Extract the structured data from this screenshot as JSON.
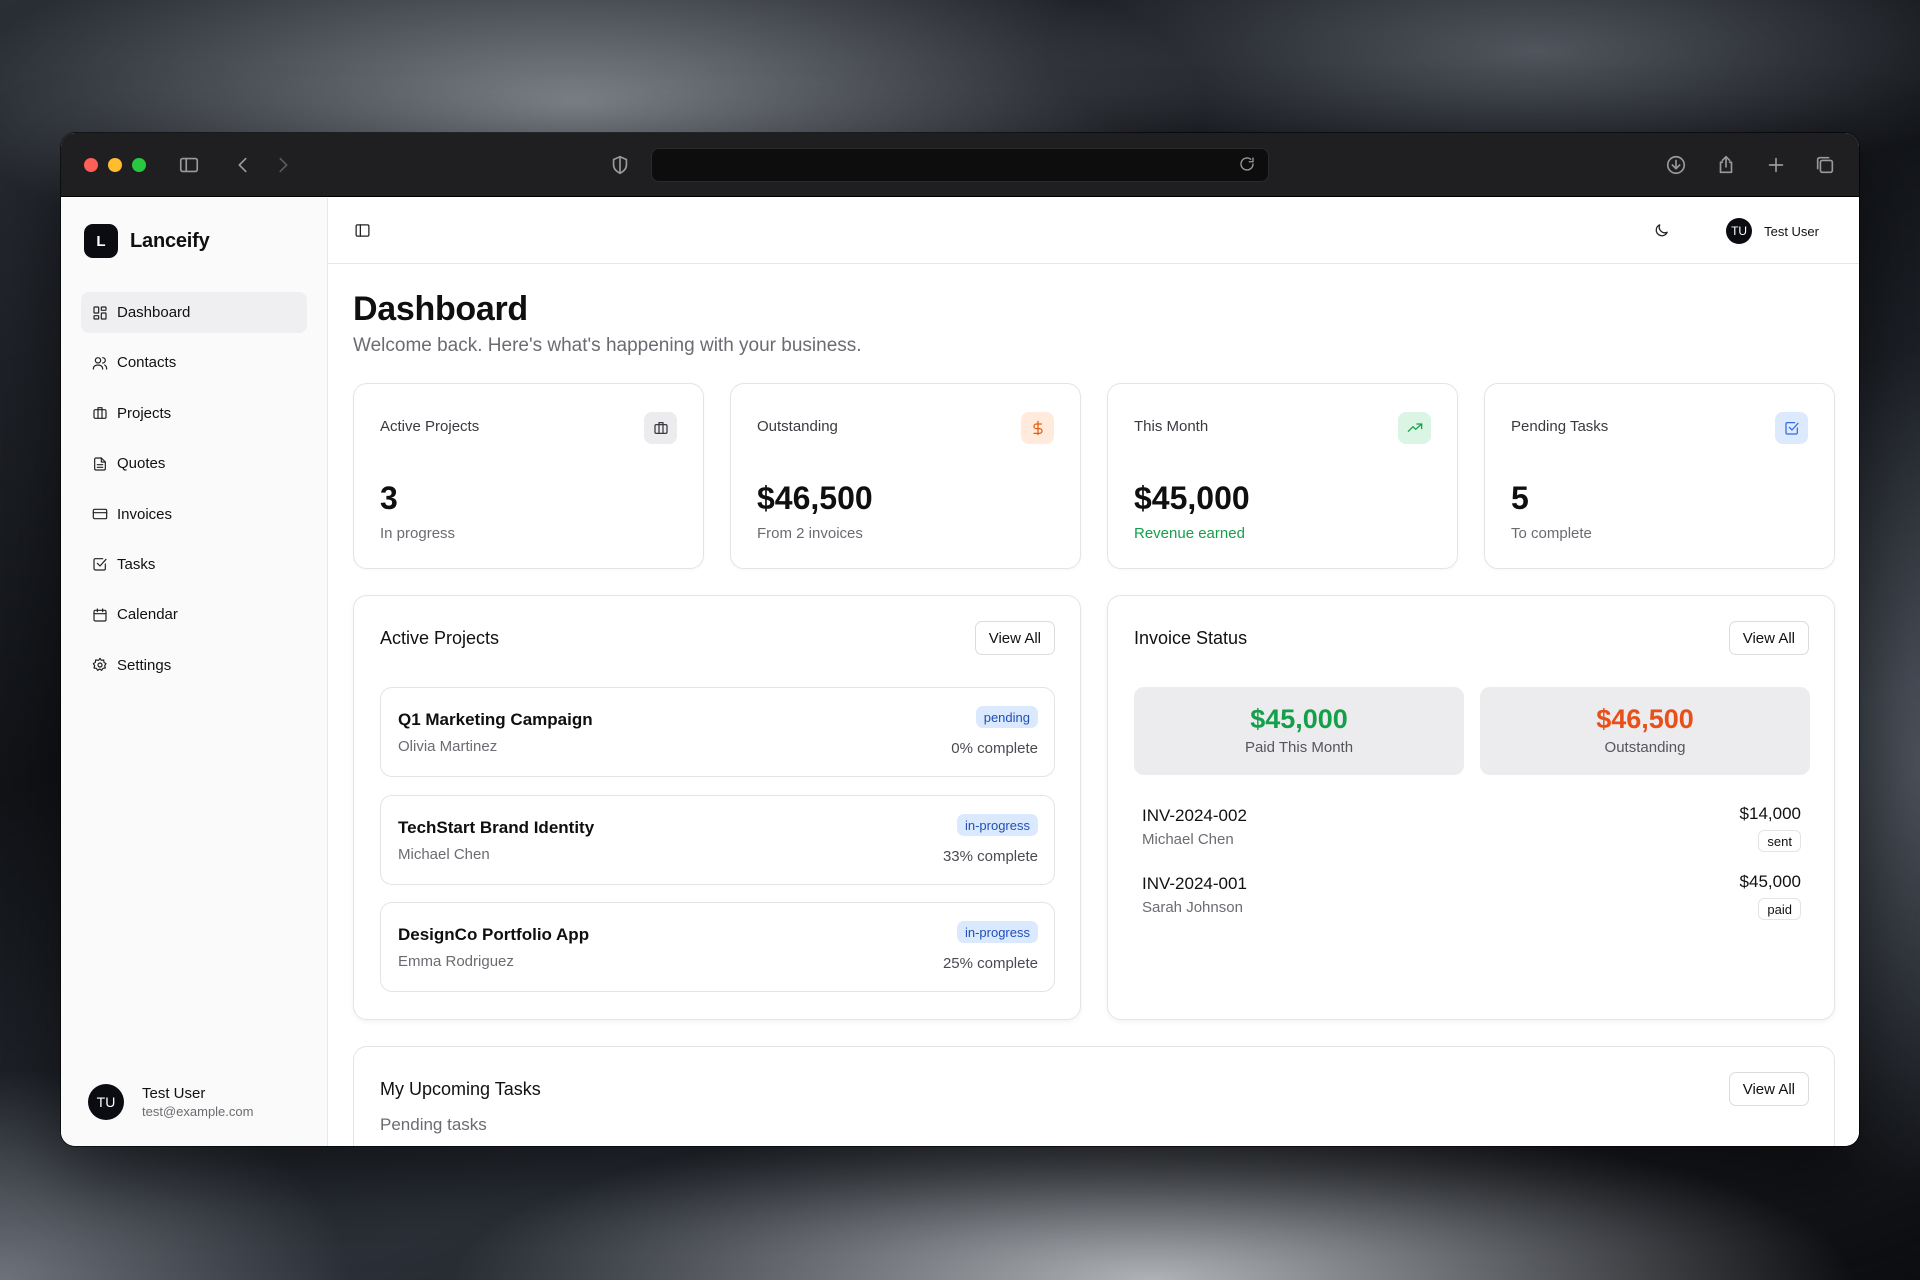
{
  "brand": {
    "logo_letter": "L",
    "name": "Lanceify"
  },
  "sidebar": {
    "items": [
      {
        "label": "Dashboard",
        "icon": "dashboard-icon",
        "active": true
      },
      {
        "label": "Contacts",
        "icon": "users-icon"
      },
      {
        "label": "Projects",
        "icon": "briefcase-icon"
      },
      {
        "label": "Quotes",
        "icon": "file-text-icon"
      },
      {
        "label": "Invoices",
        "icon": "credit-card-icon"
      },
      {
        "label": "Tasks",
        "icon": "check-square-icon"
      },
      {
        "label": "Calendar",
        "icon": "calendar-icon"
      },
      {
        "label": "Settings",
        "icon": "gear-icon"
      }
    ],
    "user": {
      "initials": "TU",
      "name": "Test User",
      "email": "test@example.com"
    }
  },
  "topbar": {
    "user_initials": "TU",
    "user_name": "Test User"
  },
  "page": {
    "title": "Dashboard",
    "subtitle": "Welcome back. Here's what's happening with your business."
  },
  "stats": [
    {
      "label": "Active Projects",
      "value": "3",
      "note": "In progress",
      "icon": "briefcase-icon",
      "color": "#3a3a40",
      "bg": "#ececef",
      "note_color": "#6b6b72"
    },
    {
      "label": "Outstanding",
      "value": "$46,500",
      "note": "From 2 invoices",
      "icon": "dollar-icon",
      "color": "#e0600f",
      "bg": "#ffeadb",
      "note_color": "#6b6b72"
    },
    {
      "label": "This Month",
      "value": "$45,000",
      "note": "Revenue earned",
      "icon": "trending-up-icon",
      "color": "#14a04a",
      "bg": "#daf5e3",
      "note_color": "#14a04a"
    },
    {
      "label": "Pending Tasks",
      "value": "5",
      "note": "To complete",
      "icon": "check-square-icon",
      "color": "#2f6fe0",
      "bg": "#dde9fc",
      "note_color": "#6b6b72"
    }
  ],
  "active_projects": {
    "title": "Active Projects",
    "view_all": "View All",
    "items": [
      {
        "name": "Q1 Marketing Campaign",
        "client": "Olivia Martinez",
        "status": "pending",
        "progress": "0% complete"
      },
      {
        "name": "TechStart Brand Identity",
        "client": "Michael Chen",
        "status": "in-progress",
        "progress": "33% complete"
      },
      {
        "name": "DesignCo Portfolio App",
        "client": "Emma Rodriguez",
        "status": "in-progress",
        "progress": "25% complete"
      }
    ]
  },
  "invoice_status": {
    "title": "Invoice Status",
    "view_all": "View All",
    "paid_amount": "$45,000",
    "paid_label": "Paid This Month",
    "paid_color": "#14a04a",
    "outstanding_amount": "$46,500",
    "outstanding_label": "Outstanding",
    "outstanding_color": "#e8501a",
    "invoices": [
      {
        "number": "INV-2024-002",
        "client": "Michael Chen",
        "amount": "$14,000",
        "status": "sent"
      },
      {
        "number": "INV-2024-001",
        "client": "Sarah Johnson",
        "amount": "$45,000",
        "status": "paid"
      }
    ]
  },
  "upcoming_tasks": {
    "title": "My Upcoming Tasks",
    "subtitle": "Pending tasks",
    "view_all": "View All"
  }
}
